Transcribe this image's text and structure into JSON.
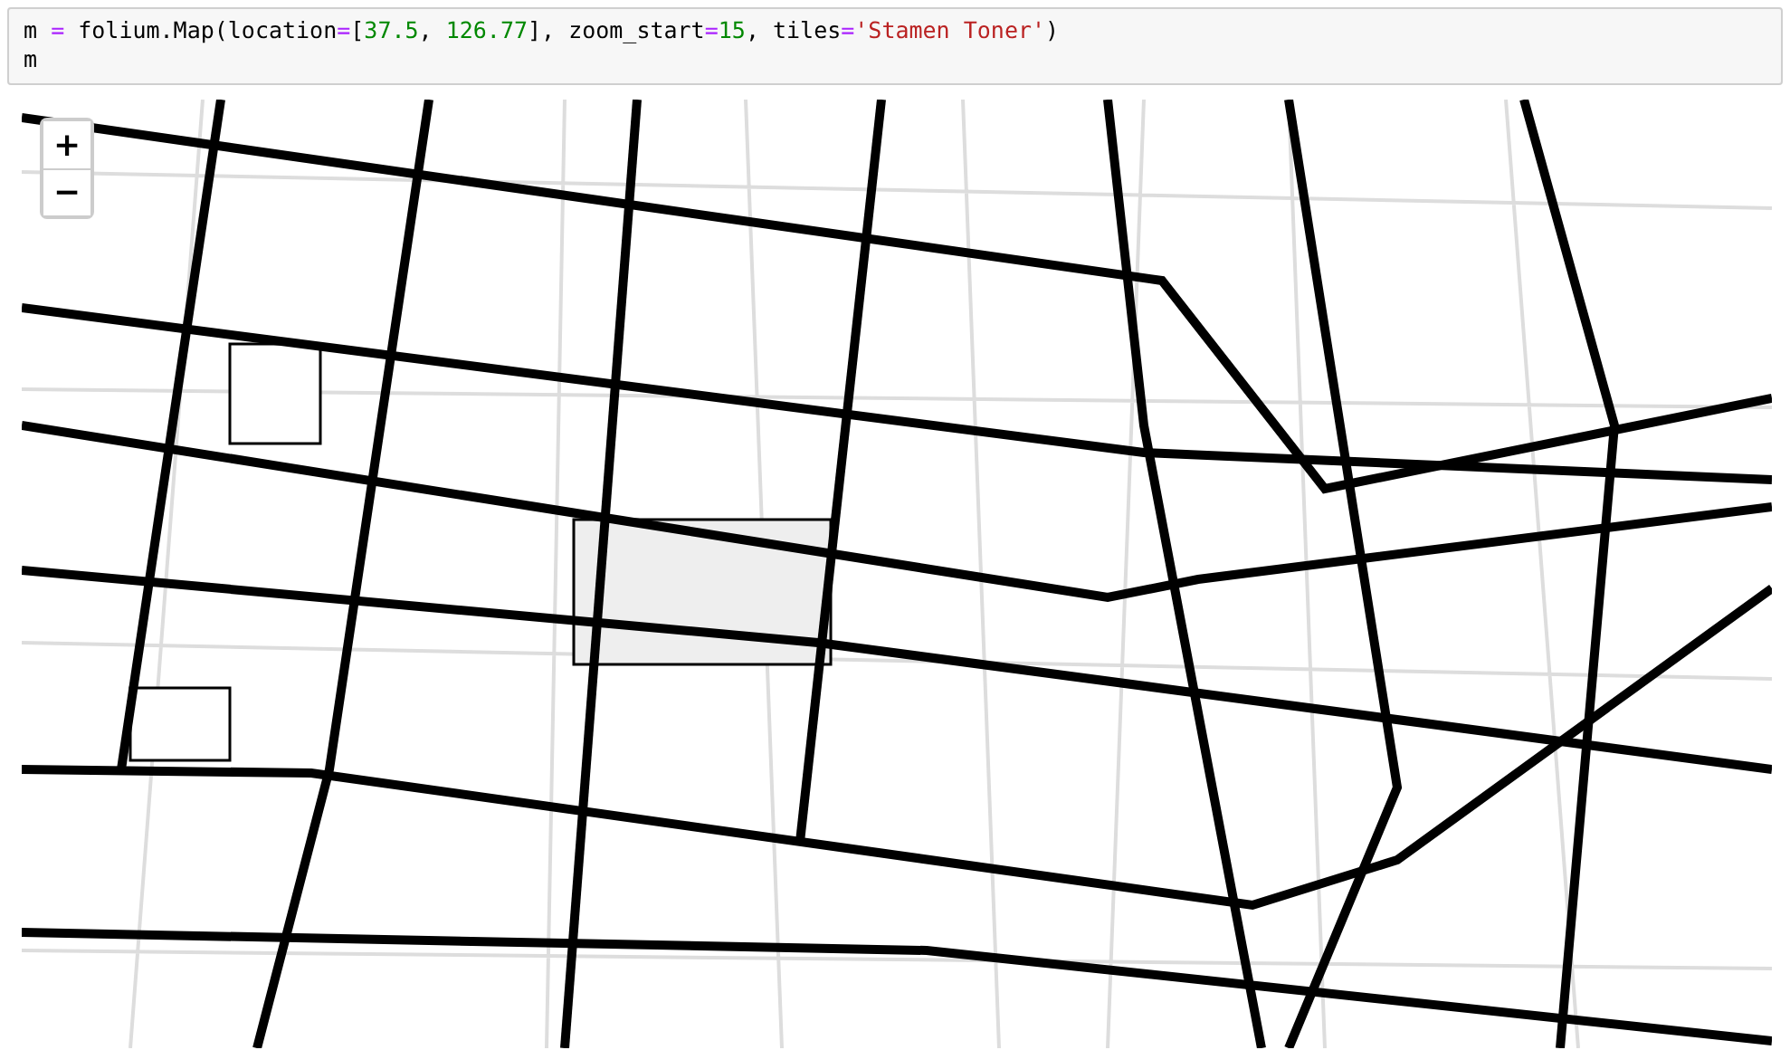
{
  "code_cell": {
    "lines": [
      [
        {
          "kind": "plain",
          "text": "m "
        },
        {
          "kind": "op",
          "text": "="
        },
        {
          "kind": "plain",
          "text": " folium.Map(location"
        },
        {
          "kind": "op",
          "text": "="
        },
        {
          "kind": "plain",
          "text": "["
        },
        {
          "kind": "number",
          "text": "37.5"
        },
        {
          "kind": "plain",
          "text": ", "
        },
        {
          "kind": "number",
          "text": "126.77"
        },
        {
          "kind": "plain",
          "text": "], zoom_start"
        },
        {
          "kind": "op",
          "text": "="
        },
        {
          "kind": "number",
          "text": "15"
        },
        {
          "kind": "plain",
          "text": ", tiles"
        },
        {
          "kind": "op",
          "text": "="
        },
        {
          "kind": "string",
          "text": "'Stamen Toner'"
        },
        {
          "kind": "plain",
          "text": ")"
        }
      ],
      [
        {
          "kind": "plain",
          "text": "m"
        }
      ]
    ]
  },
  "map": {
    "zoom_controls": [
      "+",
      "−"
    ]
  }
}
